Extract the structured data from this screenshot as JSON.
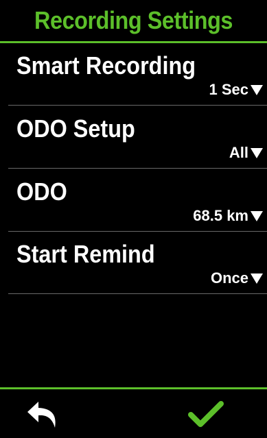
{
  "header": {
    "title": "Recording Settings"
  },
  "settings": [
    {
      "label": "Smart Recording",
      "value": "1 Sec"
    },
    {
      "label": "ODO Setup",
      "value": "All"
    },
    {
      "label": "ODO",
      "value": "68.5 km"
    },
    {
      "label": "Start Remind",
      "value": "Once"
    }
  ],
  "footer": {
    "back_icon": "back-arrow-icon",
    "confirm_icon": "checkmark-icon"
  },
  "colors": {
    "accent": "#5cbf2a",
    "background": "#000000",
    "text": "#ffffff",
    "divider": "#6a6a6a"
  }
}
